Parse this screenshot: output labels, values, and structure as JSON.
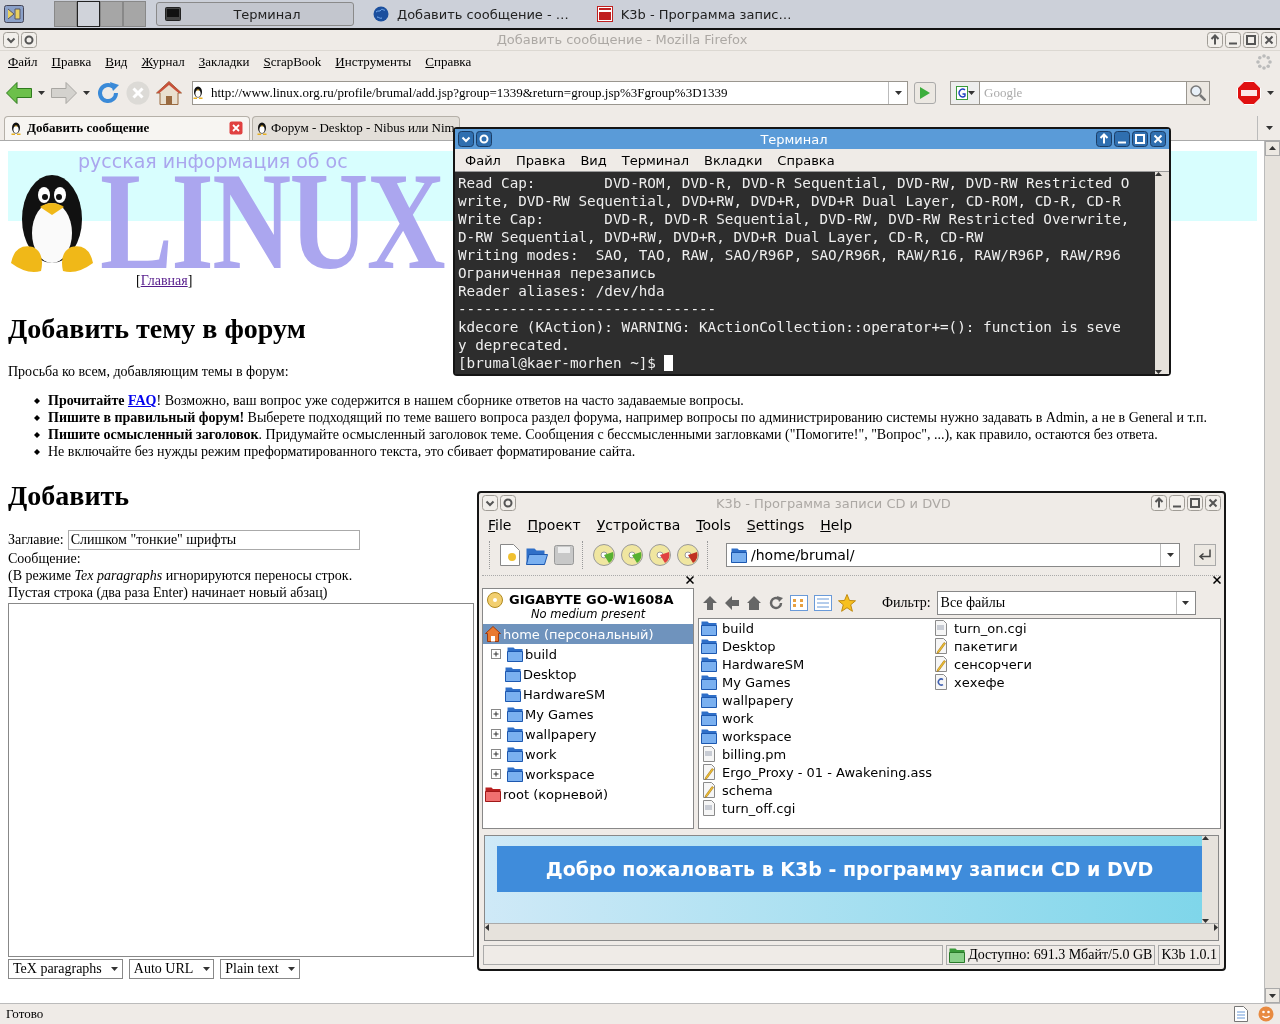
{
  "taskbar": {
    "pager": [
      {
        "selected": false
      },
      {
        "selected": true
      },
      {
        "selected": false
      },
      {
        "selected": false
      }
    ],
    "tasks": [
      {
        "label": "Терминал",
        "kind": "terminal",
        "selected": true
      },
      {
        "label": "Добавить сообщение - …",
        "kind": "browser",
        "selected": false
      },
      {
        "label": "K3b - Программа запис…",
        "kind": "k3b",
        "selected": false
      }
    ]
  },
  "browser": {
    "title": "Добавить сообщение - Mozilla Firefox",
    "menu": [
      "Файл",
      "Правка",
      "Вид",
      "Журнал",
      "Закладки",
      "ScrapBook",
      "Инструменты",
      "Справка"
    ],
    "url": "http://www.linux.org.ru/profile/brumal/add.jsp?group=1339&return=group.jsp%3Fgroup%3D1339",
    "search_placeholder": "Google",
    "tabs": [
      {
        "label": "Добавить сообщение",
        "selected": true
      },
      {
        "label": "Форум - Desktop - Nibus или Nim",
        "selected": false
      }
    ],
    "status": "Готово"
  },
  "page": {
    "logo_tagline": "русская информация об ос",
    "logo_text": "LINUX",
    "nav": {
      "before": "[",
      "link": "Главная",
      "after": "]"
    },
    "heading": "Добавить тему в форум",
    "intro": "Просьба ко всем, добавляющим темы в форум:",
    "rules": [
      {
        "parts": [
          {
            "text": "**Прочитайте** "
          },
          {
            "link": "FAQ"
          },
          {
            "text": "! Возможно, ваш вопрос уже содержится в нашем сборнике ответов на часто задаваемые вопросы."
          }
        ]
      },
      {
        "parts": [
          {
            "text": "**Пишите в правильный форум!** Выберете подходящий по теме вашего вопроса раздел форума, например вопросы по администрированию системы нужно задавать в Admin, а не в General и т.п."
          }
        ]
      },
      {
        "parts": [
          {
            "text": "**Пишите осмысленный заголовок**. Придумайте осмысленный заголовок теме. Сообщения с бессмысленными загловками (\"Помогите!\", \"Вопрос\", ...), как правило, остаются без ответа."
          }
        ]
      },
      {
        "parts": [
          {
            "text": "Не включайте без нужды режим преформатированного текста, это сбивает форматирование сайта."
          }
        ]
      }
    ],
    "form_heading": "Добавить",
    "title_label": "Заглавие:",
    "title_value": "Слишком \"тонкие\" шрифты",
    "message_label": "Сообщение:",
    "hint_lines": [
      "(В режиме *Tex paragraphs* игнорируются переносы строк.",
      "Пустая строка (два раза Enter) начинает новый абзац)"
    ],
    "selects": [
      "TeX paragraphs",
      "Auto URL",
      "Plain text"
    ]
  },
  "terminal": {
    "title": "Терминал",
    "menu": [
      "Файл",
      "Правка",
      "Вид",
      "Терминал",
      "Вкладки",
      "Справка"
    ],
    "lines": [
      "Read Cap:        DVD-ROM, DVD-R, DVD-R Sequential, DVD-RW, DVD-RW Restricted O",
      "write, DVD-RW Sequential, DVD+RW, DVD+R, DVD+R Dual Layer, CD-ROM, CD-R, CD-R",
      "Write Cap:       DVD-R, DVD-R Sequential, DVD-RW, DVD-RW Restricted Overwrite,",
      "D-RW Sequential, DVD+RW, DVD+R, DVD+R Dual Layer, CD-R, CD-RW",
      "Writing modes:  SAO, TAO, RAW, SAO/R96P, SAO/R96R, RAW/R16, RAW/R96P, RAW/R96",
      "Ограниченная перезапись",
      "Reader aliases: /dev/hda",
      "------------------------------",
      "kdecore (KAction): WARNING: KActionCollection::operator+=(): function is seve",
      "y deprecated."
    ],
    "prompt": "[brumal@kaer-morhen ~]$"
  },
  "k3b": {
    "title": "K3b - Программа записи CD и DVD",
    "menu": [
      "File",
      "Проект",
      "Устройства",
      "Tools",
      "Settings",
      "Help"
    ],
    "path": "/home/brumal/",
    "device": {
      "name": "GIGABYTE GO-W1608A",
      "status": "No medium present"
    },
    "tree": [
      {
        "label": "home (персональный)",
        "kind": "home",
        "selected": true,
        "expandable": false,
        "children": [
          {
            "label": "build",
            "kind": "folder",
            "selected": false,
            "expandable": true
          },
          {
            "label": "Desktop",
            "kind": "folder",
            "selected": false,
            "expandable": false
          },
          {
            "label": "HardwareSM",
            "kind": "folder",
            "selected": false,
            "expandable": false
          },
          {
            "label": "My Games",
            "kind": "folder",
            "selected": false,
            "expandable": true
          },
          {
            "label": "wallpapery",
            "kind": "folder",
            "selected": false,
            "expandable": true
          },
          {
            "label": "work",
            "kind": "folder",
            "selected": false,
            "expandable": true
          },
          {
            "label": "workspace",
            "kind": "folder",
            "selected": false,
            "expandable": true
          }
        ]
      },
      {
        "label": "root (корневой)",
        "kind": "root",
        "selected": false,
        "expandable": false
      }
    ],
    "filter_label": "Фильтр:",
    "filter_value": "Все файлы",
    "files": [
      {
        "name": "build",
        "kind": "folder"
      },
      {
        "name": "Desktop",
        "kind": "folder"
      },
      {
        "name": "HardwareSM",
        "kind": "folder"
      },
      {
        "name": "My Games",
        "kind": "folder"
      },
      {
        "name": "wallpapery",
        "kind": "folder"
      },
      {
        "name": "work",
        "kind": "folder"
      },
      {
        "name": "workspace",
        "kind": "folder"
      },
      {
        "name": "billing.pm",
        "kind": "script"
      },
      {
        "name": "Ergo_Proxy - 01 - Awakening.ass",
        "kind": "text"
      },
      {
        "name": "schema",
        "kind": "text"
      },
      {
        "name": "turn_off.cgi",
        "kind": "script"
      },
      {
        "name": "turn_on.cgi",
        "kind": "script"
      },
      {
        "name": "пакетиги",
        "kind": "text"
      },
      {
        "name": "сенсорчеги",
        "kind": "text"
      },
      {
        "name": "хехефе",
        "kind": "source"
      }
    ],
    "welcome": "Добро пожаловать в K3b - программу записи CD и DVD",
    "free": "Доступно: 691.3 Мбайт/5.0 GB",
    "version": "K3b 1.0.1"
  }
}
